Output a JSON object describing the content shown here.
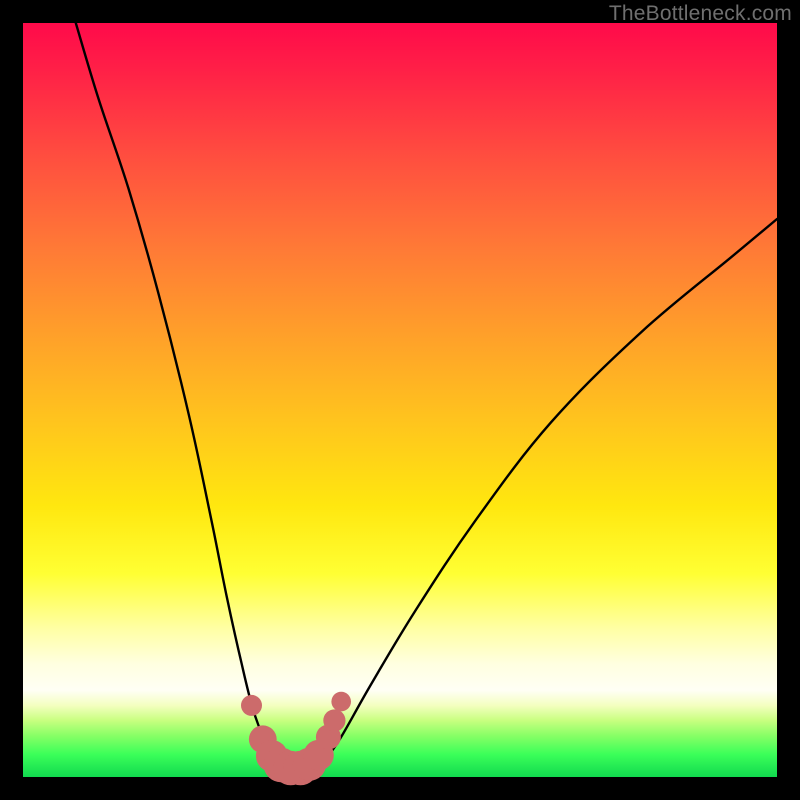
{
  "watermark": "TheBottleneck.com",
  "chart_data": {
    "type": "line",
    "title": "",
    "xlabel": "",
    "ylabel": "",
    "xlim": [
      0,
      100
    ],
    "ylim": [
      0,
      100
    ],
    "series": [
      {
        "name": "bottleneck-curve",
        "x": [
          7,
          10,
          14,
          18,
          22,
          25,
          27,
          29,
          30.5,
          32,
          33.5,
          35,
          36.5,
          38,
          40,
          42,
          46,
          52,
          60,
          70,
          82,
          94,
          100
        ],
        "values": [
          100,
          90,
          78,
          64,
          48,
          34,
          24,
          15,
          9,
          5,
          2.5,
          1.4,
          1.1,
          1.4,
          2.5,
          5,
          12,
          22,
          34,
          47,
          59,
          69,
          74
        ]
      }
    ],
    "markers": {
      "name": "bottom-dot-cluster",
      "color": "#cc6b6b",
      "points": [
        {
          "x": 30.3,
          "y": 9.5,
          "r": 1.1
        },
        {
          "x": 31.8,
          "y": 5.0,
          "r": 1.6
        },
        {
          "x": 33.0,
          "y": 2.8,
          "r": 1.9
        },
        {
          "x": 34.2,
          "y": 1.6,
          "r": 2.1
        },
        {
          "x": 35.5,
          "y": 1.2,
          "r": 2.1
        },
        {
          "x": 36.8,
          "y": 1.2,
          "r": 2.1
        },
        {
          "x": 38.0,
          "y": 1.7,
          "r": 2.0
        },
        {
          "x": 39.2,
          "y": 2.9,
          "r": 1.8
        },
        {
          "x": 40.5,
          "y": 5.3,
          "r": 1.4
        },
        {
          "x": 41.3,
          "y": 7.5,
          "r": 1.2
        },
        {
          "x": 42.2,
          "y": 10.0,
          "r": 1.0
        }
      ]
    }
  }
}
